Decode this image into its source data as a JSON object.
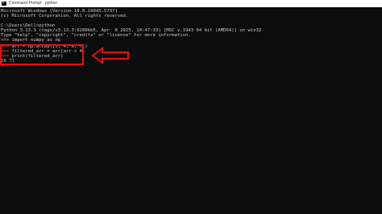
{
  "window": {
    "title": "Command Prompt - python",
    "icon": "cmd-icon"
  },
  "console": {
    "lines": [
      "Microsoft Windows [Version 10.0.19045.5737]",
      "(c) Microsoft Corporation. All rights reserved.",
      "",
      "C:\\Users\\Dell>python",
      "Python 3.13.3 (tags/v3.13.3:6280bb5, Apr  8 2025, 14:47:33) [MSC v.1943 64 bit (AMD64)] on win32",
      "Type \"help\", \"copyright\", \"credits\" or \"license\" for more information.",
      ">>> import numpy as np"
    ],
    "highlighted": [
      {
        "prompt": ">>>",
        "code": " arr = np.array([3, 4, 6, 7])"
      },
      {
        "prompt": ">>>",
        "code": " filtered_arr = arr[arr > 4]"
      },
      {
        "prompt": ">>>",
        "code": " print(filtered_arr)"
      },
      {
        "prompt": "",
        "code": "[6 7]"
      }
    ],
    "final_prompt": ">>>"
  },
  "colors": {
    "background": "#0c0c0c",
    "text": "#cccccc",
    "annotation": "#e60f0f"
  }
}
